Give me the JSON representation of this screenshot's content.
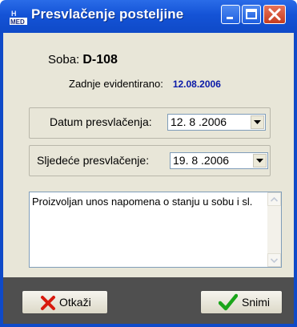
{
  "window": {
    "title": "Presvlačenje posteljine",
    "icon": "med-app-icon"
  },
  "room": {
    "label": "Soba:",
    "value": "D-108"
  },
  "last_recorded": {
    "label": "Zadnje evidentirano:",
    "date": "12.08.2006"
  },
  "change_date": {
    "label": "Datum presvlačenja:",
    "value": "12. 8 .2006"
  },
  "next_change": {
    "label": "Sljedeće presvlačenje:",
    "value": "19. 8 .2006"
  },
  "notes": {
    "value": "Proizvoljan unos napomena o stanju u sobu i sl."
  },
  "buttons": {
    "cancel": "Otkaži",
    "save": "Snimi"
  }
}
